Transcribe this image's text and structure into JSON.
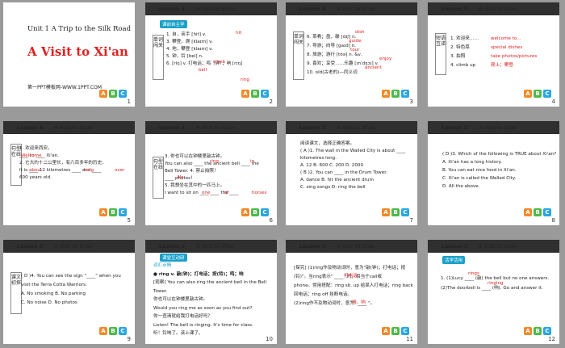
{
  "slides": [
    {
      "num": "1",
      "unit": "Unit 1  A Trip to the Silk Road",
      "title": "A  Visit  to  Xi'an",
      "sub": "第一PPT模板网-WWW.1PPT.COM"
    },
    {
      "num": "2",
      "lesson": "Lesson 3",
      "topic": "A Visit to Xi'an",
      "tag": "课前自主学",
      "side": "单词闯关",
      "lines": [
        "1. 自，亲手 [hit] v.",
        "2. 使（某人）……感到 ____",
        "3. 攀登，爬 [klaɪm] v.",
        "4. 地，攀登 [klaɪm] v.",
        "5. 钟，铃 [bel] n.",
        "6. [ríŋ] v. 打电话；鸣（钟）；响 [rɪŋ]"
      ],
      "answers": [
        "hit",
        "hit",
        "climb",
        "bell",
        "ring"
      ]
    },
    {
      "num": "3",
      "lesson": "Lesson 3",
      "topic": "A Visit to Xi'an",
      "side": "单词闯关",
      "lines": [
        "6. 菜肴；盘，碟 [dɪʃ] n.",
        "7. 导游；向导 [gaɪd] n.",
        "8. 旅游；游行 [tʊə] n. &v.",
        "9. 喜欢；享受……乐趣 [ɪnˈdʒɔɪ] v.",
        "10. old(古老的)—同义词"
      ],
      "answers": [
        "dish",
        "guide",
        "tour",
        "enjoy",
        "ancient"
      ]
    },
    {
      "num": "4",
      "lesson": "Lesson 3",
      "topic": "A Visit to Xi'an",
      "side": "短语互译",
      "lines": [
        "1. 欢迎来……",
        "2. 特色菜",
        "3. 拍照",
        "4. climb up"
      ],
      "answers": [
        "welcome to...",
        "special dishes",
        "take photos/pictures",
        "爬上；攀登"
      ]
    },
    {
      "num": "5",
      "lesson": "Lesson 3",
      "topic": "A Visit to Xi'an",
      "side": "句型在线",
      "lines": [
        "1. 欢迎来西安。",
        "____ to ____ Xi'an.",
        "2. 它大约十二公里长，有六百多年的历史。",
        "It is ____ 12 kilometres ____ and ____",
        "600 years old."
      ],
      "answers": [
        "Welcome",
        "about",
        "long",
        "over"
      ]
    },
    {
      "num": "6",
      "lesson": "Lesson 3",
      "topic": "A Visit to Xi'an",
      "side": "句型在线",
      "lines": [
        "3. 你也可以在钟楼里敲古钟。",
        "You can also ____ the ancient bell ____ the",
        "Bell Tower.  4. 禁止拍照！",
        "____ photos！",
        "5. 我想坐在其中的一匹马上。",
        "I want to sit on ____ ____ the ____"
      ],
      "answers": [
        "ring",
        "in",
        "No",
        "one",
        "of",
        "horses"
      ]
    },
    {
      "num": "7",
      "lesson": "Lesson 3",
      "topic": "A Visit to Xi'an",
      "side": "",
      "lines": [
        "阅读课文，选择正确答案。",
        "( A )1. The wall in the Walled City is about ____",
        "kilometres long.",
        "A. 12      B. 600      C. 200      D. 2000",
        "( B )2. You can ____ in the Drum Tower.",
        "A. dance          B. hit the ancient drum",
        "C. sing songs          D. ring the bell"
      ],
      "answers": []
    },
    {
      "num": "8",
      "lesson": "Lesson 3",
      "topic": "A Visit to Xi'an",
      "side": "",
      "lines": [
        "( D )3. Which of the following is TRUE about Xi'an?",
        "A. Xi'an has a long history.",
        "B. You can eat nice food in Xi'an.",
        "C. Xi'an is called the Walled City.",
        "D. All the above."
      ],
      "answers": []
    },
    {
      "num": "9",
      "lesson": "Lesson 3",
      "topic": "A Visit to Xi'an",
      "side": "课文初探",
      "lines": [
        "( D )4. You can see the sign \"____\" when you",
        "visit the Terra Cotta Warriors.",
        "A. No smoking          B. No parking",
        "C. No noise          D. No photos"
      ],
      "answers": []
    },
    {
      "num": "10",
      "lesson": "Lesson 3",
      "topic": "A Visit to Xi'an",
      "tag": "课堂互动研",
      "lines": [
        "词汇点睛",
        "● ring v. 敲(钟)；打电话；按(铃)；鸣；响",
        "[观察] You can also ring the ancient bell in the Bell Tower.",
        "你也可以在钟楼里敲古钟。",
        "Would you ring me as soon as you find out?",
        "你一查清就给我打电话好吗？",
        "Listen! The bell is ringing. It's time for class.",
        "听！铃响了。该上课了。"
      ],
      "answers": []
    },
    {
      "num": "11",
      "lesson": "Lesson 3",
      "topic": "A Visit to Xi'an",
      "lines": [
        "[探究] (1)ring作及物动词时，意为\"敲(钟)；打电话；按",
        "(铃)\"。当ring表示\" ____ \"时，相当于call或",
        "phone。常用搭配：ring sb. up 给某人打电话；ring back",
        "回电话；ring off 挂断电话。",
        "(2)ring作不及物动词时，意为\" ____ \"。"
      ],
      "answers": [
        "打电话",
        "鸣，响"
      ]
    },
    {
      "num": "12",
      "lesson": "Lesson 3",
      "topic": "A Visit to Xi'an",
      "tag": "活学活用",
      "lines": [
        "1. (1)Lucy ____ (敲) the bell but no one answers.",
        "(2)The doorbell is ____ (响). Go and answer it."
      ],
      "answers": [
        "rings",
        "ringing"
      ]
    }
  ]
}
